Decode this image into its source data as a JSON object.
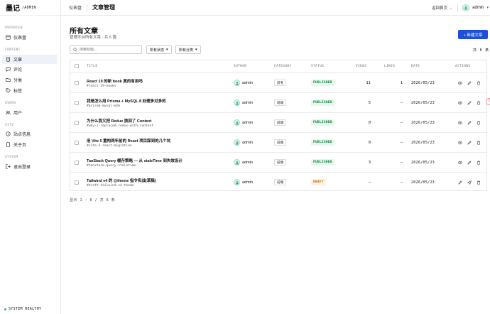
{
  "brand": {
    "name": "墨记",
    "sub": "/ADMIN"
  },
  "sidebar": {
    "sections": [
      {
        "label": "OVERVIEW",
        "items": [
          {
            "label": "仪表盘",
            "icon": "dashboard-icon"
          }
        ]
      },
      {
        "label": "CONTENT",
        "items": [
          {
            "label": "文章",
            "icon": "document-icon",
            "active": true
          },
          {
            "label": "评论",
            "icon": "comment-icon"
          },
          {
            "label": "分类",
            "icon": "folder-icon"
          },
          {
            "label": "标签",
            "icon": "tag-icon"
          }
        ]
      },
      {
        "label": "USERS",
        "items": [
          {
            "label": "用户",
            "icon": "users-icon"
          }
        ]
      },
      {
        "label": "SITE",
        "items": [
          {
            "label": "站点信息",
            "icon": "info-icon"
          },
          {
            "label": "关于页",
            "icon": "page-icon"
          }
        ]
      },
      {
        "label": "SYSTEM",
        "items": [
          {
            "label": "退出登录",
            "icon": "logout-icon"
          }
        ]
      }
    ],
    "health": "SYSTEM HEALTHY"
  },
  "header": {
    "breadcrumb_parent": "仪表盘",
    "breadcrumb_current": "文章管理",
    "back_link": "返回首页 →",
    "user": "admin"
  },
  "main": {
    "title": "所有文章",
    "subtitle": "管理平台所有文章 · 共 6 篇",
    "new_button": "+  新建文章",
    "search_placeholder": "搜索标题...",
    "status_filter": "所有状态",
    "category_filter": "所有分类",
    "total_label": "共 6 条",
    "columns": {
      "title": "TITLE",
      "author": "AUTHOR",
      "category": "CATEGORY",
      "status": "STATUS",
      "views": "VIEWS",
      "likes": "LIKES",
      "date": "DATE",
      "actions": "ACTIONS"
    },
    "rows": [
      {
        "title": "React 19 的新 hook 真的有用吗",
        "slug": "#react-19-hooks",
        "author": "admin",
        "category": "思考",
        "status": "PUBLISHED",
        "views": "11",
        "likes": "1",
        "date": "2026/05/23"
      },
      {
        "title": "我是怎么用 Prisma + MySQL 8 处理多对多的",
        "slug": "#prisma-mysql-m2m",
        "author": "admin",
        "category": "前端",
        "status": "PUBLISHED",
        "views": "5",
        "likes": "–",
        "date": "2026/05/23"
      },
      {
        "title": "为什么我又把 Redux 换回了 Context",
        "slug": "#why-i-replaced-redux-with-context",
        "author": "admin",
        "category": "前端",
        "status": "PUBLISHED",
        "views": "0",
        "likes": "–",
        "date": "2026/05/23"
      },
      {
        "title": "用 Vite 5 重构两年前的 React 项目踩到的几个坑",
        "slug": "#vite-5-react-migration",
        "author": "admin",
        "category": "前端",
        "status": "PUBLISHED",
        "views": "0",
        "likes": "–",
        "date": "2026/05/23"
      },
      {
        "title": "TanStack Query 缓存策略 — 从 staleTime 到失效设计",
        "slug": "#tanstack-query-staletime",
        "author": "admin",
        "category": "前端",
        "status": "PUBLISHED",
        "views": "3",
        "likes": "–",
        "date": "2026/05/23"
      },
      {
        "title": "Tailwind v4 的 @theme 指令实战(草稿)",
        "slug": "#draft-tailwind-v4-theme",
        "author": "admin",
        "category": "前端",
        "status": "DRAFT",
        "views": "–",
        "likes": "–",
        "date": "2026/05/23"
      }
    ],
    "footer": "显示 1 - 6 / 共 6 条"
  },
  "colors": {
    "primary": "#1d4fd8",
    "published": "#15803d",
    "draft": "#c2700b",
    "health": "#22c55e"
  }
}
